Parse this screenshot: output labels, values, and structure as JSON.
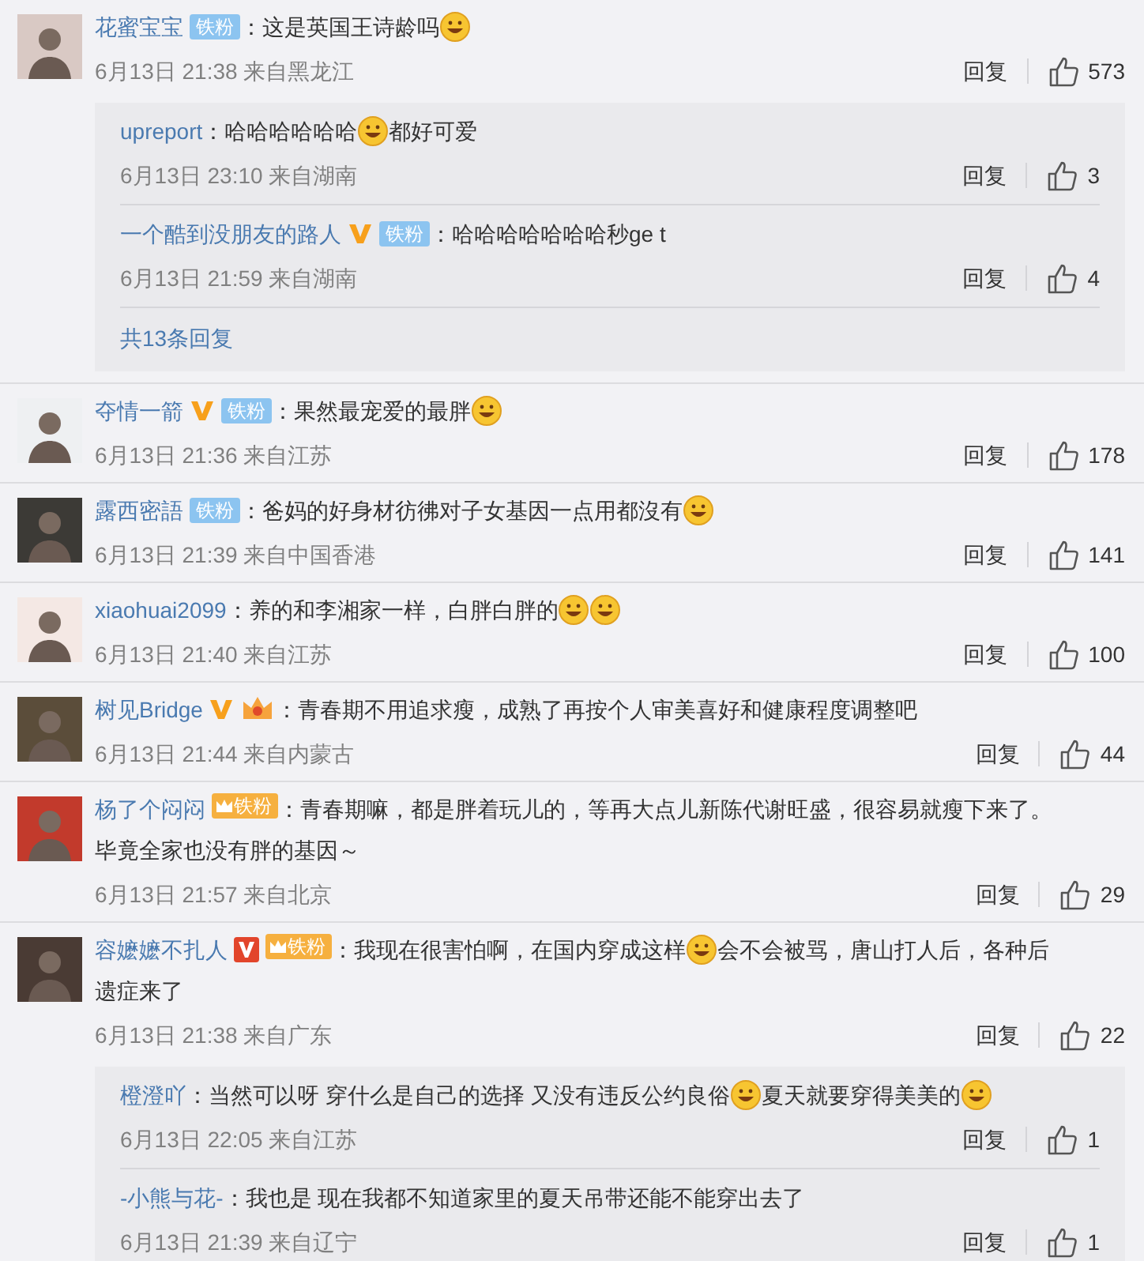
{
  "comments": [
    {
      "user": "花蜜宝宝",
      "badges": [
        {
          "kind": "fan",
          "label": "铁粉"
        }
      ],
      "parts": [
        {
          "kind": "text",
          "text": "：这是英国王诗龄吗"
        },
        {
          "kind": "emoji"
        }
      ],
      "time": "6月13日 21:38 来自黑龙江",
      "reply_label": "回复",
      "likes": "573",
      "replies": [
        {
          "user": "upreport",
          "parts": [
            {
              "kind": "text",
              "text": "：哈哈哈哈哈哈"
            },
            {
              "kind": "emoji"
            },
            {
              "kind": "text",
              "text": "都好可爱"
            }
          ],
          "time": "6月13日 23:10 来自湖南",
          "reply_label": "回复",
          "likes": "3"
        },
        {
          "user": "一个酷到没朋友的路人",
          "badges": [
            {
              "kind": "v-gold"
            },
            {
              "kind": "fan",
              "label": "铁粉"
            }
          ],
          "parts": [
            {
              "kind": "text",
              "text": "：哈哈哈哈哈哈哈秒ge t"
            }
          ],
          "time": "6月13日 21:59 来自湖南",
          "reply_label": "回复",
          "likes": "4"
        }
      ],
      "more": "共13条回复"
    },
    {
      "user": "夺情一箭",
      "badges": [
        {
          "kind": "v-gold"
        },
        {
          "kind": "fan",
          "label": "铁粉"
        }
      ],
      "parts": [
        {
          "kind": "text",
          "text": "：果然最宠爱的最胖"
        },
        {
          "kind": "emoji"
        }
      ],
      "time": "6月13日 21:36 来自江苏",
      "reply_label": "回复",
      "likes": "178"
    },
    {
      "user": "露西密語",
      "badges": [
        {
          "kind": "fan",
          "label": "铁粉"
        }
      ],
      "parts": [
        {
          "kind": "text",
          "text": "：爸妈的好身材彷彿对子女基因一点用都沒有"
        },
        {
          "kind": "emoji"
        }
      ],
      "time": "6月13日 21:39 来自中国香港",
      "reply_label": "回复",
      "likes": "141"
    },
    {
      "user": "xiaohuai2099",
      "parts": [
        {
          "kind": "text",
          "text": "：养的和李湘家一样，白胖白胖的"
        },
        {
          "kind": "emoji"
        },
        {
          "kind": "emoji"
        }
      ],
      "time": "6月13日 21:40 来自江苏",
      "reply_label": "回复",
      "likes": "100"
    },
    {
      "user": "树见Bridge",
      "badges": [
        {
          "kind": "v-gold"
        },
        {
          "kind": "crown"
        }
      ],
      "parts": [
        {
          "kind": "text",
          "text": "：青春期不用追求瘦，成熟了再按个人审美喜好和健康程度调整吧"
        }
      ],
      "time": "6月13日 21:44 来自内蒙古",
      "reply_label": "回复",
      "likes": "44"
    },
    {
      "user": "杨了个闷闷",
      "badges": [
        {
          "kind": "fan-gold",
          "label": "铁粉"
        }
      ],
      "parts": [
        {
          "kind": "text",
          "text": "：青春期嘛，都是胖着玩儿的，等再大点儿新陈代谢旺盛，很容易就瘦下来了。"
        },
        {
          "kind": "line",
          "text": "毕竟全家也没有胖的基因～"
        }
      ],
      "time": "6月13日 21:57 来自北京",
      "reply_label": "回复",
      "likes": "29"
    },
    {
      "user": "容嬷嬷不扎人",
      "badges": [
        {
          "kind": "v-red"
        },
        {
          "kind": "fan-gold",
          "label": "铁粉"
        }
      ],
      "parts": [
        {
          "kind": "text",
          "text": "：我现在很害怕啊，在国内穿成这样"
        },
        {
          "kind": "emoji"
        },
        {
          "kind": "text",
          "text": "会不会被骂，唐山打人后，各种后"
        },
        {
          "kind": "line",
          "text": "遗症来了"
        }
      ],
      "time": "6月13日 21:38 来自广东",
      "reply_label": "回复",
      "likes": "22",
      "replies": [
        {
          "user": "橙澄吖",
          "parts": [
            {
              "kind": "text",
              "text": "：当然可以呀 穿什么是自己的选择 又没有违反公约良俗"
            },
            {
              "kind": "emoji"
            },
            {
              "kind": "text",
              "text": "夏天就要穿得美美的"
            },
            {
              "kind": "emoji"
            }
          ],
          "time": "6月13日 22:05 来自江苏",
          "reply_label": "回复",
          "likes": "1"
        },
        {
          "user": "-小熊与花-",
          "parts": [
            {
              "kind": "text",
              "text": "：我也是 现在我都不知道家里的夏天吊带还能不能穿出去了"
            }
          ],
          "time": "6月13日 21:39 来自辽宁",
          "reply_label": "回复",
          "likes": "1"
        }
      ]
    }
  ]
}
